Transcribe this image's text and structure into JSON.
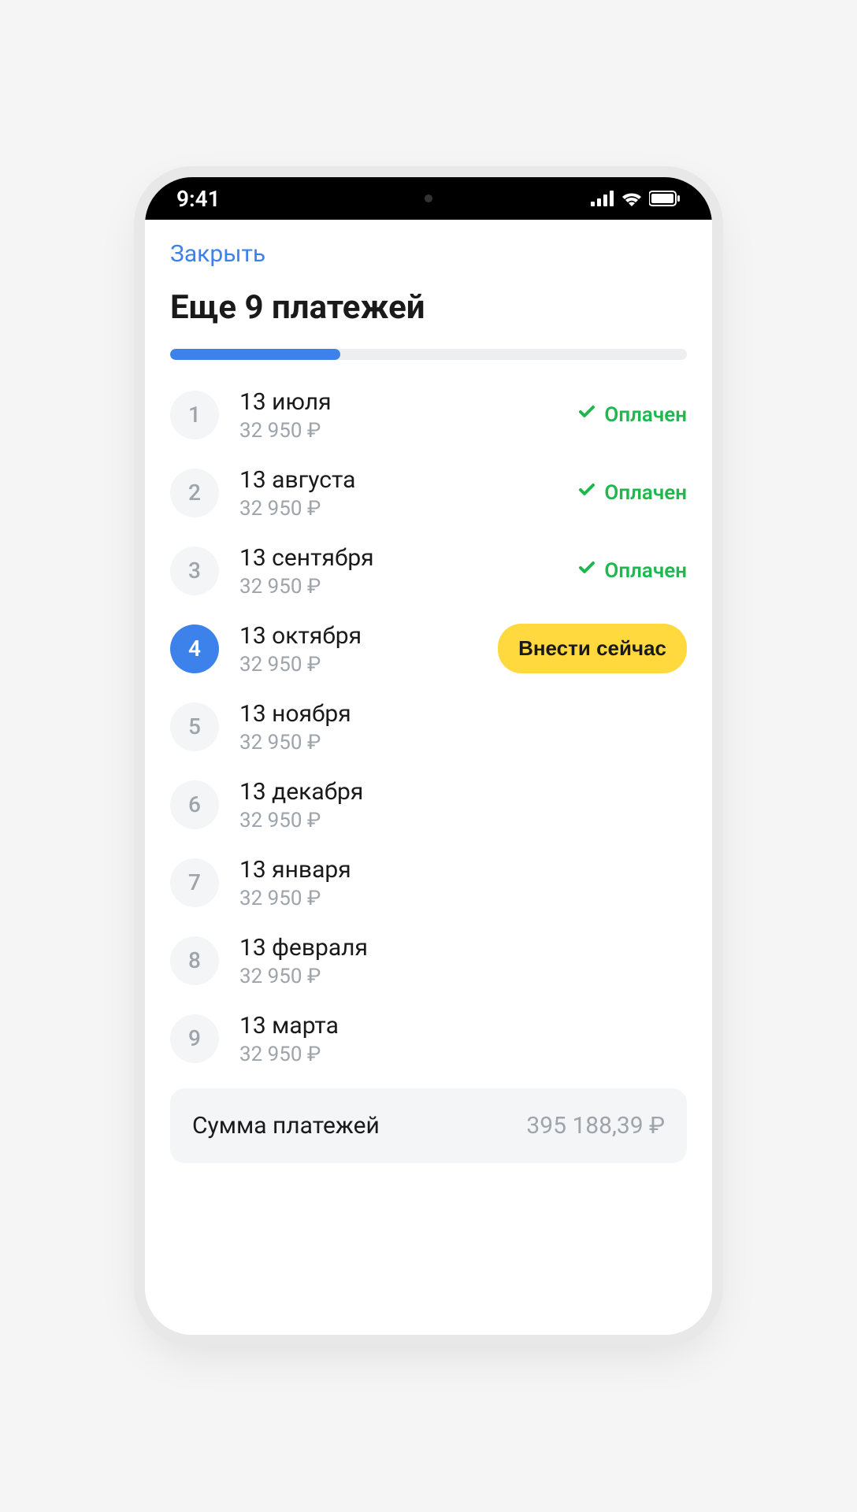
{
  "statusbar": {
    "time": "9:41"
  },
  "header": {
    "close": "Закрыть",
    "title": "Еще 9 платежей"
  },
  "progress": {
    "percent": 33
  },
  "paid_label": "Оплачен",
  "pay_now_label": "Внести сейчас",
  "payments": [
    {
      "index": "1",
      "date": "13 июля",
      "amount": "32 950 ₽",
      "status": "paid"
    },
    {
      "index": "2",
      "date": "13 августа",
      "amount": "32 950 ₽",
      "status": "paid"
    },
    {
      "index": "3",
      "date": "13 сентября",
      "amount": "32 950 ₽",
      "status": "paid"
    },
    {
      "index": "4",
      "date": "13 октября",
      "amount": "32 950 ₽",
      "status": "due"
    },
    {
      "index": "5",
      "date": "13 ноября",
      "amount": "32 950 ₽",
      "status": "future"
    },
    {
      "index": "6",
      "date": "13 декабря",
      "amount": "32 950 ₽",
      "status": "future"
    },
    {
      "index": "7",
      "date": "13 января",
      "amount": "32 950 ₽",
      "status": "future"
    },
    {
      "index": "8",
      "date": "13 февраля",
      "amount": "32 950 ₽",
      "status": "future"
    },
    {
      "index": "9",
      "date": "13 марта",
      "amount": "32 950 ₽",
      "status": "future"
    }
  ],
  "summary": {
    "label": "Сумма платежей",
    "value": "395 188,39 ₽"
  }
}
